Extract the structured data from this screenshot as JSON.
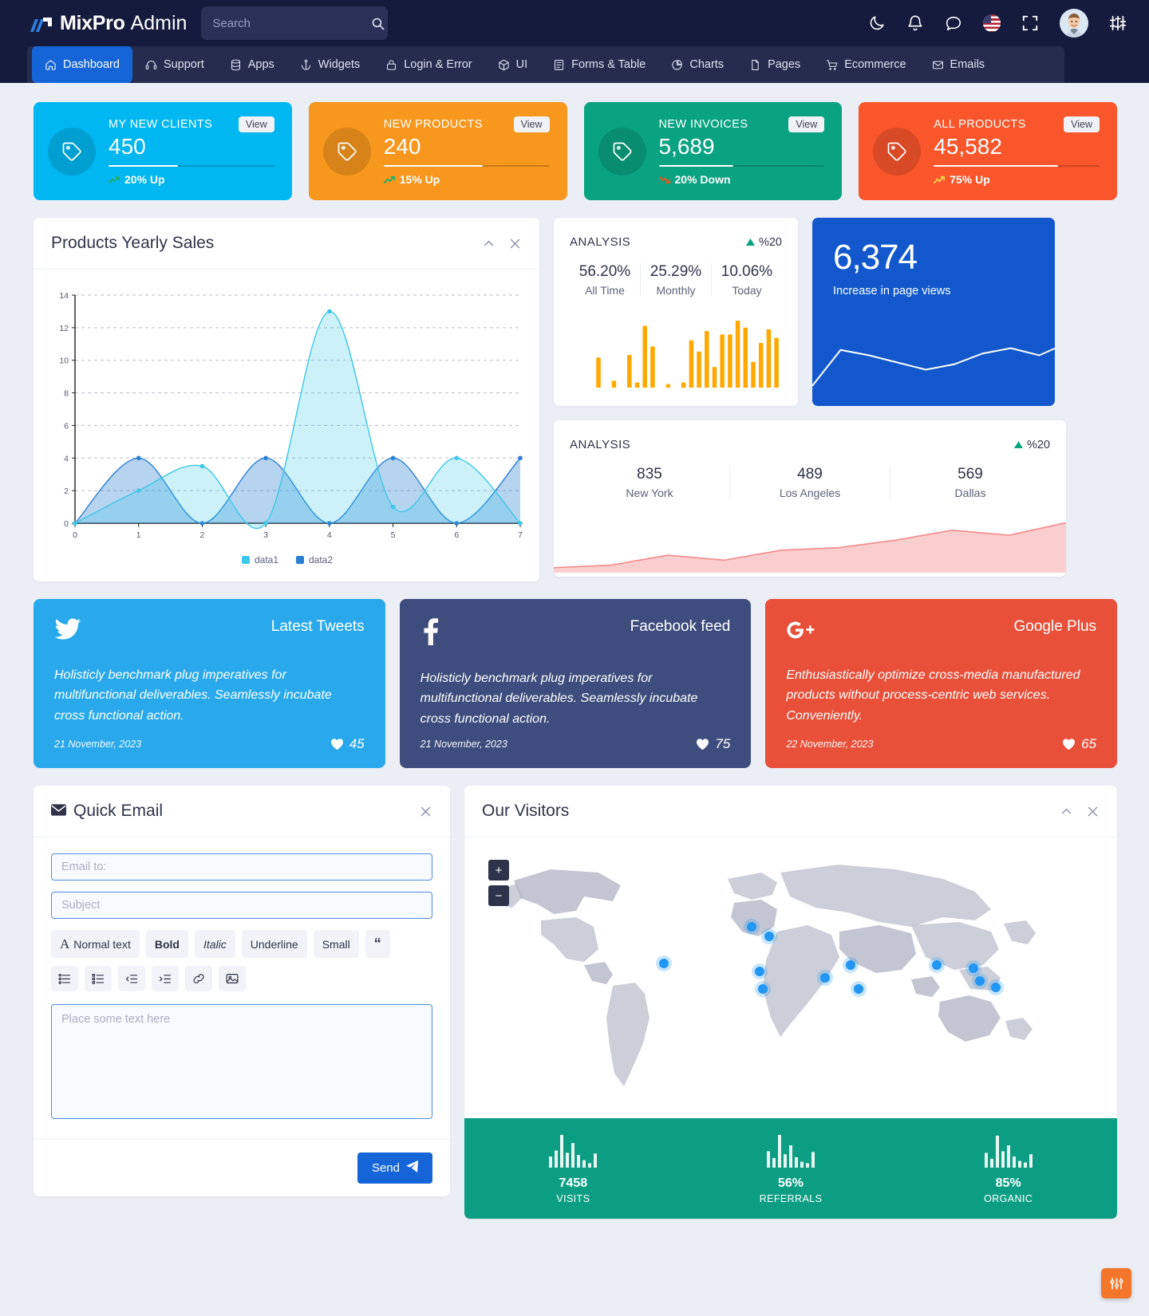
{
  "header": {
    "brand_strong": "MixPro",
    "brand_light": "Admin",
    "search_placeholder": "Search",
    "search_value": "",
    "icons": [
      "moon-icon",
      "bell-icon",
      "chat-icon",
      "flag-us-icon",
      "fullscreen-icon",
      "avatar",
      "settings-sliders-icon"
    ]
  },
  "nav": {
    "items": [
      {
        "label": "Dashboard",
        "icon": "home-icon",
        "active": true
      },
      {
        "label": "Support",
        "icon": "headset-icon",
        "active": false
      },
      {
        "label": "Apps",
        "icon": "database-icon",
        "active": false
      },
      {
        "label": "Widgets",
        "icon": "anchor-icon",
        "active": false
      },
      {
        "label": "Login & Error",
        "icon": "lock-icon",
        "active": false
      },
      {
        "label": "UI",
        "icon": "box-icon",
        "active": false
      },
      {
        "label": "Forms & Table",
        "icon": "form-icon",
        "active": false
      },
      {
        "label": "Charts",
        "icon": "pie-icon",
        "active": false
      },
      {
        "label": "Pages",
        "icon": "file-icon",
        "active": false
      },
      {
        "label": "Ecommerce",
        "icon": "cart-icon",
        "active": false
      },
      {
        "label": "Emails",
        "icon": "envelope-icon",
        "active": false
      }
    ]
  },
  "stats": [
    {
      "title": "MY NEW CLIENTS",
      "value": "450",
      "delta": "20% Up",
      "trend": "up",
      "view": "View",
      "color": "#00b7f1",
      "progress": 42,
      "delta_color": "#1fae6a"
    },
    {
      "title": "NEW PRODUCTS",
      "value": "240",
      "delta": "15% Up",
      "trend": "up",
      "view": "View",
      "color": "#f7971d",
      "progress": 60,
      "delta_color": "#1fae6a"
    },
    {
      "title": "NEW INVOICES",
      "value": "5,689",
      "delta": "20% Down",
      "trend": "down",
      "view": "View",
      "color": "#0aa382",
      "progress": 45,
      "delta_color": "#f4510f"
    },
    {
      "title": "ALL PRODUCTS",
      "value": "45,582",
      "delta": "75% Up",
      "trend": "up",
      "view": "View",
      "color": "#f9562b",
      "progress": 75,
      "delta_color": "#ffd34e"
    }
  ],
  "sales_panel": {
    "title": "Products Yearly Sales",
    "collapse_icon": "chevron-up-icon",
    "close_icon": "close-icon"
  },
  "chart_data": {
    "type": "area",
    "title": "Products Yearly Sales",
    "xlabel": "",
    "ylabel": "",
    "x": [
      0,
      1,
      2,
      3,
      4,
      5,
      6,
      7
    ],
    "xlim": [
      0,
      7
    ],
    "ylim": [
      0,
      14
    ],
    "yticks": [
      0,
      2,
      4,
      6,
      8,
      10,
      12,
      14
    ],
    "grid": true,
    "legend_position": "bottom",
    "series": [
      {
        "name": "data1",
        "color": "#3cc8e8",
        "values": [
          0,
          2,
          3.5,
          0,
          13,
          1,
          4,
          0
        ]
      },
      {
        "name": "data2",
        "color": "#2a7fd4",
        "values": [
          0,
          4,
          0,
          4,
          0,
          4,
          0,
          4
        ]
      }
    ]
  },
  "analysis_top": {
    "label": "ANALYSIS",
    "pct": "%20",
    "pct_trend": "up",
    "cols": [
      {
        "value": "56.20%",
        "caption": "All Time"
      },
      {
        "value": "25.29%",
        "caption": "Monthly"
      },
      {
        "value": "10.06%",
        "caption": "Today"
      }
    ],
    "bars": [
      0,
      0,
      0,
      35,
      0,
      8,
      0,
      38,
      6,
      72,
      48,
      0,
      4,
      0,
      6,
      55,
      42,
      66,
      24,
      62,
      62,
      78,
      70,
      30,
      52,
      68,
      58
    ],
    "bar_color": "#ffa800"
  },
  "page_views": {
    "value": "6,374",
    "caption": "Increase in page views",
    "bg": "#1258cc",
    "spark": [
      18,
      58,
      52,
      44,
      36,
      42,
      54,
      60,
      52,
      66
    ]
  },
  "analysis_bottom": {
    "label": "ANALYSIS",
    "pct": "%20",
    "pct_trend": "up",
    "cols": [
      {
        "value": "835",
        "caption": "New York"
      },
      {
        "value": "489",
        "caption": "Los Angeles"
      },
      {
        "value": "569",
        "caption": "Dallas"
      }
    ],
    "spark": [
      4,
      6,
      14,
      10,
      18,
      20,
      26,
      34,
      30,
      40
    ],
    "spark_color": "#f48a8a"
  },
  "social": [
    {
      "name": "Latest Tweets",
      "icon": "twitter-icon",
      "text": "Holisticly benchmark plug imperatives for multifunctional deliverables. Seamlessly incubate cross functional action.",
      "date": "21 November, 2023",
      "likes": "45",
      "bg": "#29a9eb"
    },
    {
      "name": "Facebook feed",
      "icon": "facebook-icon",
      "text": "Holisticly benchmark plug imperatives for multifunctional deliverables. Seamlessly incubate cross functional action.",
      "date": "21 November, 2023",
      "likes": "75",
      "bg": "#3f4d7e"
    },
    {
      "name": "Google Plus",
      "icon": "google-plus-icon",
      "text": "Enthusiastically optimize cross-media manufactured products without process-centric web services. Conveniently.",
      "date": "22 November, 2023",
      "likes": "65",
      "bg": "#e8503a"
    }
  ],
  "quick_email": {
    "title": "Quick Email",
    "title_icon": "envelope-icon",
    "close_icon": "close-icon",
    "email_placeholder": "Email to:",
    "email_value": "",
    "subject_placeholder": "Subject",
    "subject_value": "",
    "body_placeholder": "Place some text here",
    "body_value": "",
    "toolbar_row1": [
      {
        "label": "Normal text",
        "icon": "font-size-icon",
        "style": "normal"
      },
      {
        "label": "Bold",
        "icon": "bold-icon",
        "style": "bold"
      },
      {
        "label": "Italic",
        "icon": "italic-icon",
        "style": "italic"
      },
      {
        "label": "Underline",
        "icon": "underline-icon",
        "style": "normal"
      },
      {
        "label": "Small",
        "icon": "small-text-icon",
        "style": "normal"
      },
      {
        "label": "“",
        "icon": "quote-icon",
        "style": "quote"
      }
    ],
    "toolbar_row2": [
      "list-ul-icon",
      "list-ol-icon",
      "outdent-icon",
      "indent-icon",
      "link-icon",
      "image-icon"
    ],
    "send_label": "Send",
    "send_icon": "paper-plane-icon"
  },
  "visitors": {
    "title": "Our Visitors",
    "collapse_icon": "chevron-up-icon",
    "close_icon": "close-icon",
    "zoom_in": "+",
    "zoom_out": "−",
    "stats": [
      {
        "value": "7458",
        "caption": "VISITS",
        "bars": [
          30,
          46,
          88,
          40,
          66,
          34,
          20,
          12,
          38
        ]
      },
      {
        "value": "56%",
        "caption": "REFERRALS",
        "bars": [
          44,
          26,
          88,
          36,
          60,
          28,
          16,
          12,
          42
        ]
      },
      {
        "value": "85%",
        "caption": "ORGANIC",
        "bars": [
          40,
          24,
          86,
          44,
          60,
          30,
          18,
          14,
          36
        ]
      }
    ],
    "footer_bg": "#0c9e83"
  },
  "fab": {
    "icon": "settings-icon",
    "color": "#f4762a"
  }
}
